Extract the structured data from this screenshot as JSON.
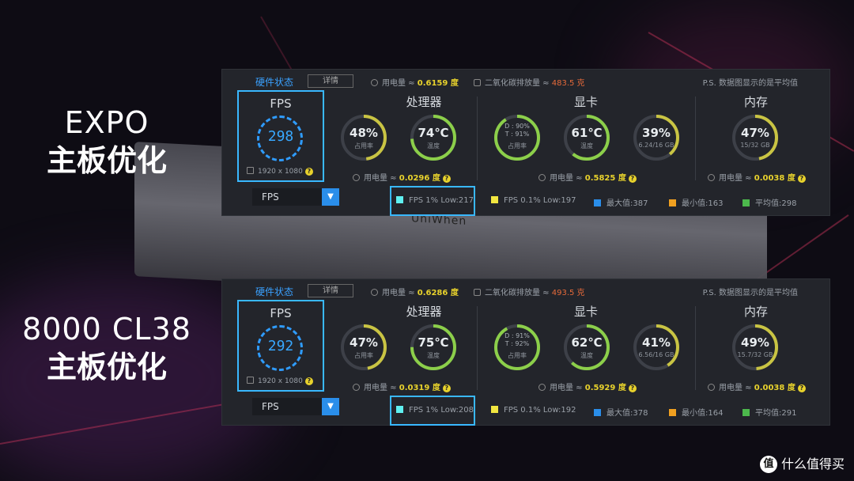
{
  "labels": [
    {
      "line1": "EXPO",
      "line2": "主板优化"
    },
    {
      "line1": "8000 CL38",
      "line2": "主板优化"
    }
  ],
  "ram_brand": "UniWhen",
  "colors": {
    "accent": "#39b8ff",
    "fps_low1": "#5ff0f0",
    "fps_low01": "#f2e640",
    "max": "#2a8eea",
    "min": "#f0a020",
    "avg": "#4cb84c"
  },
  "panels": [
    {
      "header": {
        "title": "硬件状态",
        "detail_label": "详情",
        "power_label": "用电量 ≈",
        "power_value": "0.6159 度",
        "co2_label": "二氧化碳排放量 ≈",
        "co2_value": "483.5 克",
        "ps_note": "P.S. 数据图显示的是平均值"
      },
      "fps": {
        "caption": "FPS",
        "value": "298",
        "resolution": "1920 x 1080"
      },
      "dropdown": {
        "value": "FPS"
      },
      "cpu": {
        "title": "处理器",
        "usage": "48%",
        "usage_label": "占用率",
        "usage_pct": 48,
        "temp": "74℃",
        "temp_label": "温度",
        "temp_pct": 74,
        "power_label": "用电量 ≈",
        "power_value": "0.0296 度"
      },
      "gpu": {
        "title": "显卡",
        "usage_detail": [
          "D : 90%",
          "T : 91%"
        ],
        "usage_label": "占用率",
        "usage_pct": 91,
        "temp": "61℃",
        "temp_label": "温度",
        "temp_pct": 61,
        "vram": "39%",
        "vram_sub": "6.24/16 GB",
        "vram_pct": 39,
        "power_label": "用电量 ≈",
        "power_value": "0.5825 度"
      },
      "mem": {
        "title": "内存",
        "usage": "47%",
        "usage_sub": "15/32 GB",
        "usage_pct": 47,
        "power_label": "用电量 ≈",
        "power_value": "0.0038 度"
      },
      "legend": [
        "FPS 1% Low:217",
        "FPS 0.1% Low:197",
        "最大值:387",
        "最小值:163",
        "平均值:298"
      ]
    },
    {
      "header": {
        "title": "硬件状态",
        "detail_label": "详情",
        "power_label": "用电量 ≈",
        "power_value": "0.6286 度",
        "co2_label": "二氧化碳排放量 ≈",
        "co2_value": "493.5 克",
        "ps_note": "P.S. 数据图显示的是平均值"
      },
      "fps": {
        "caption": "FPS",
        "value": "292",
        "resolution": "1920 x 1080"
      },
      "dropdown": {
        "value": "FPS"
      },
      "cpu": {
        "title": "处理器",
        "usage": "47%",
        "usage_label": "占用率",
        "usage_pct": 47,
        "temp": "75℃",
        "temp_label": "温度",
        "temp_pct": 75,
        "power_label": "用电量 ≈",
        "power_value": "0.0319 度"
      },
      "gpu": {
        "title": "显卡",
        "usage_detail": [
          "D : 91%",
          "T : 92%"
        ],
        "usage_label": "占用率",
        "usage_pct": 92,
        "temp": "62℃",
        "temp_label": "温度",
        "temp_pct": 62,
        "vram": "41%",
        "vram_sub": "6.56/16 GB",
        "vram_pct": 41,
        "power_label": "用电量 ≈",
        "power_value": "0.5929 度"
      },
      "mem": {
        "title": "内存",
        "usage": "49%",
        "usage_sub": "15.7/32 GB",
        "usage_pct": 49,
        "power_label": "用电量 ≈",
        "power_value": "0.0038 度"
      },
      "legend": [
        "FPS 1% Low:208",
        "FPS 0.1% Low:192",
        "最大值:378",
        "最小值:164",
        "平均值:291"
      ]
    }
  ],
  "watermark": {
    "icon": "值",
    "text": "什么值得买"
  }
}
